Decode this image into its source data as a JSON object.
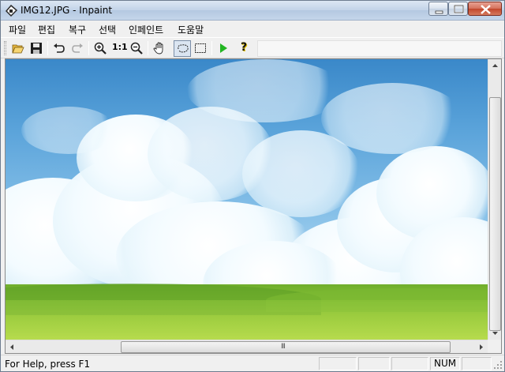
{
  "window": {
    "title": "IMG12.JPG - Inpaint"
  },
  "menu": {
    "items": [
      {
        "label": "파일"
      },
      {
        "label": "편집"
      },
      {
        "label": "복구"
      },
      {
        "label": "선택"
      },
      {
        "label": "인페인트"
      },
      {
        "label": "도움말"
      }
    ]
  },
  "toolbar": {
    "buttons": [
      {
        "icon": "open-folder-icon"
      },
      {
        "icon": "save-icon"
      },
      {
        "icon": "undo-icon"
      },
      {
        "icon": "redo-icon"
      },
      {
        "icon": "zoom-in-icon"
      },
      {
        "icon": "actual-size-icon",
        "label": "1:1"
      },
      {
        "icon": "zoom-out-icon"
      },
      {
        "icon": "hand-pan-icon"
      },
      {
        "icon": "lasso-select-icon",
        "pressed": true
      },
      {
        "icon": "rect-select-icon"
      },
      {
        "icon": "run-inpaint-icon"
      },
      {
        "icon": "help-icon",
        "label": "?"
      }
    ]
  },
  "statusbar": {
    "help_text": "For Help, press F1",
    "num_indicator": "NUM"
  },
  "scrollbar": {
    "grip": "III"
  },
  "colors": {
    "accent_green": "#22b522",
    "close_red": "#c2462c",
    "help_yellow": "#e5c400"
  }
}
